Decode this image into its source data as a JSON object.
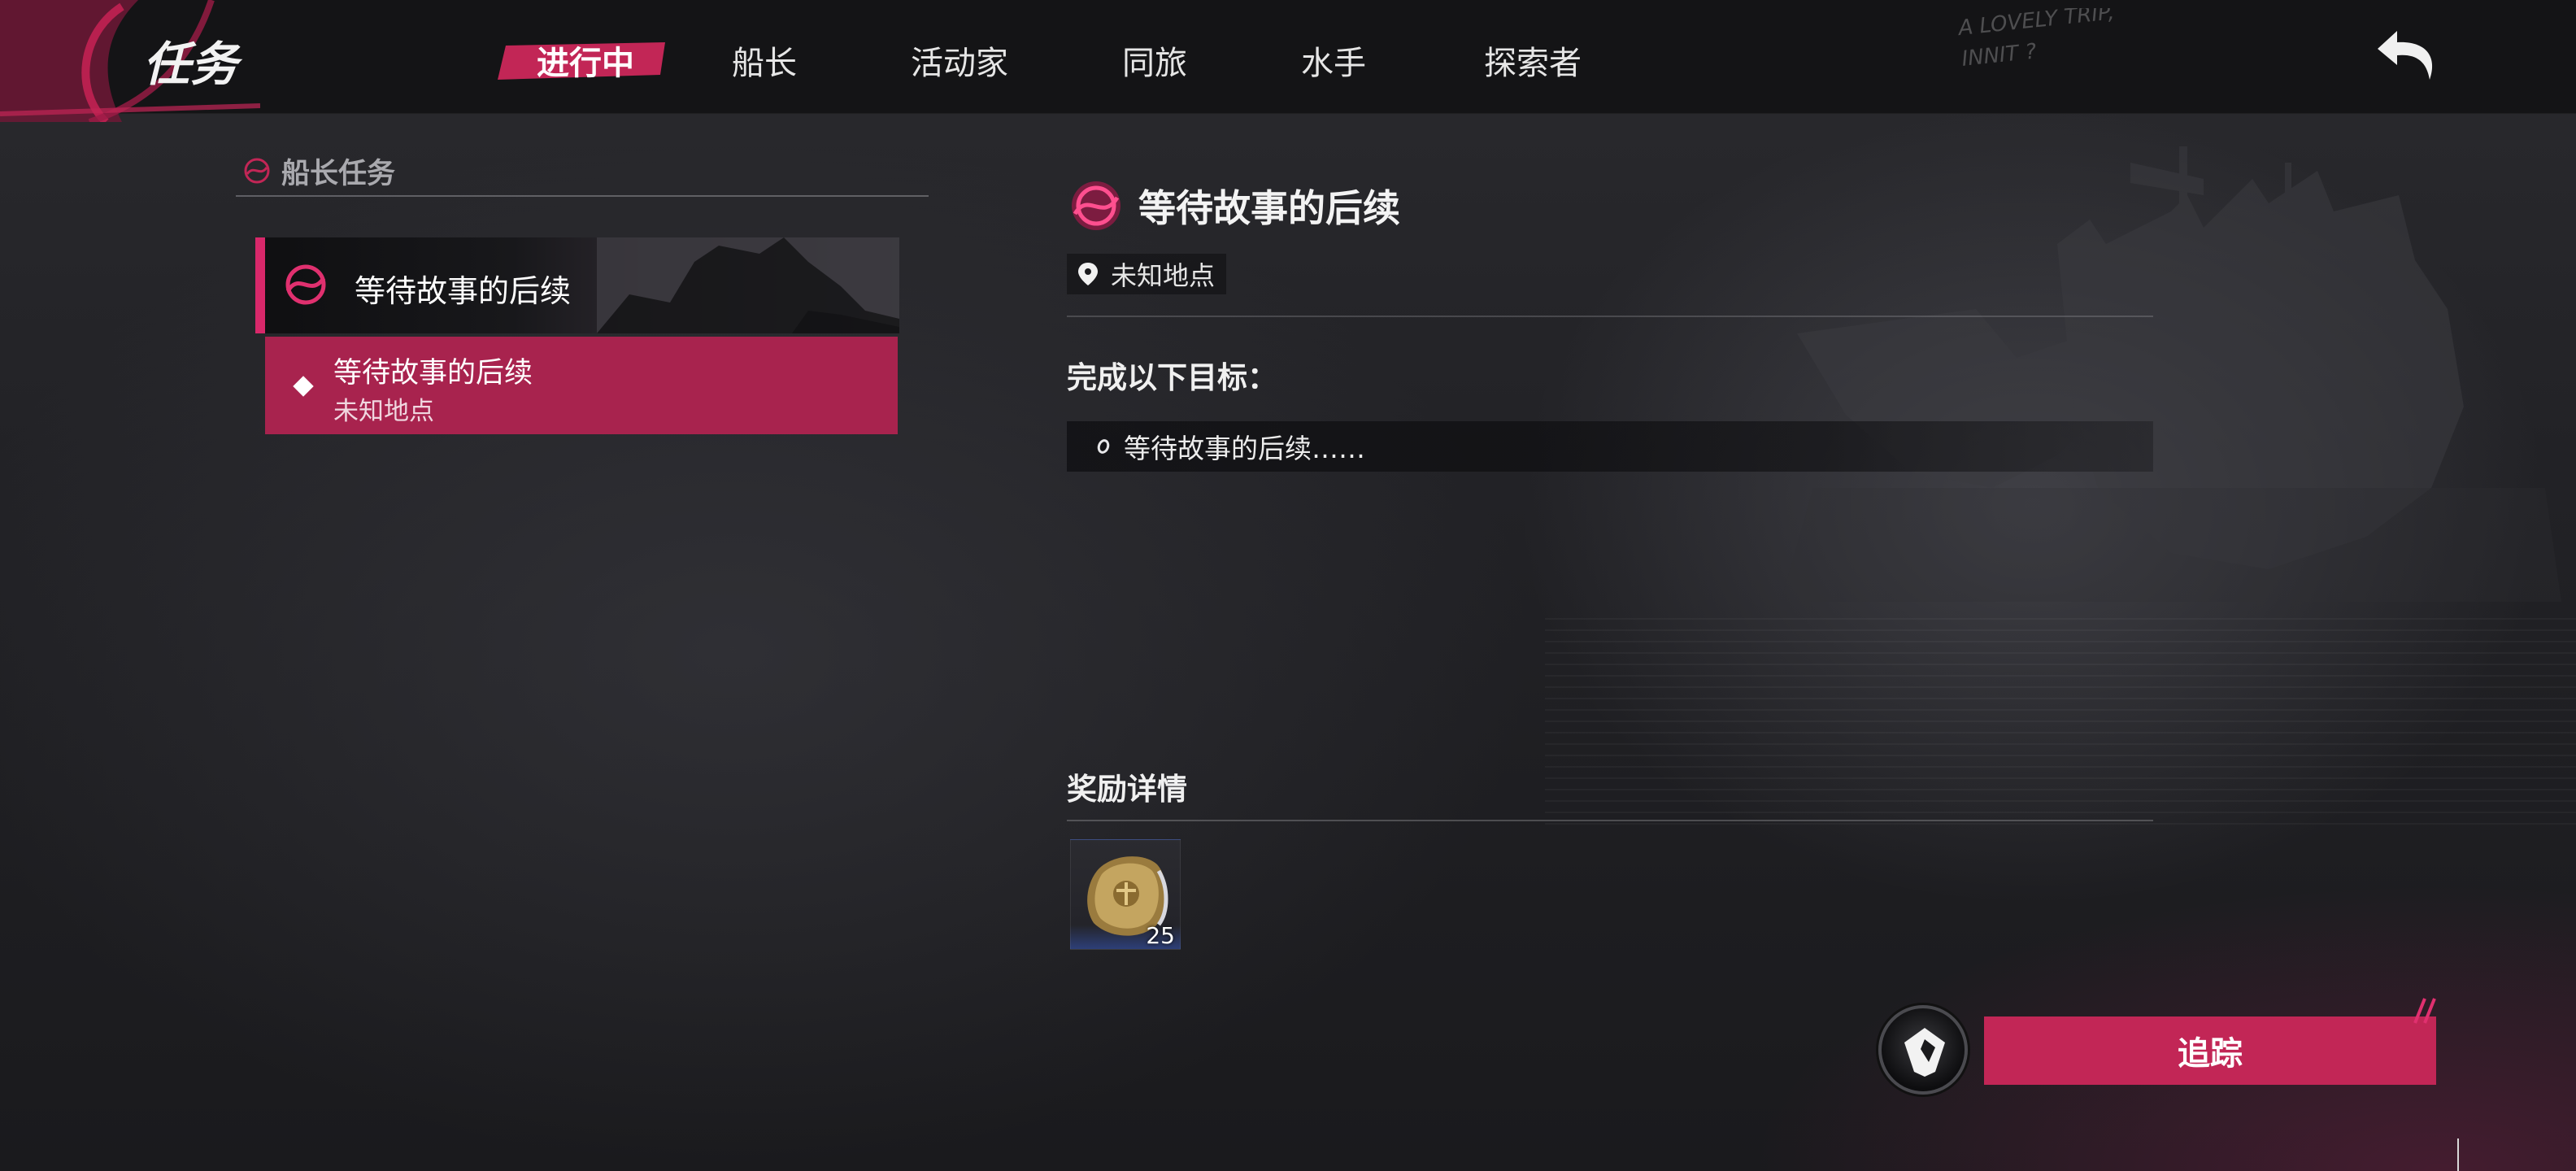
{
  "header": {
    "title": "任务",
    "tabs": [
      {
        "label": "进行中",
        "active": true
      },
      {
        "label": "船长",
        "active": false
      },
      {
        "label": "活动家",
        "active": false
      },
      {
        "label": "同旅",
        "active": false
      },
      {
        "label": "水手",
        "active": false
      },
      {
        "label": "探索者",
        "active": false
      }
    ],
    "back_icon": "back-arrow-icon",
    "scrawl_text": "A LOVELY TRIP, INNIT?"
  },
  "quest_list": {
    "category_title": "船长任务",
    "category_icon": "captain-emblem-icon",
    "selected_quest": {
      "title": "等待故事的后续",
      "icon": "captain-emblem-icon"
    },
    "sub_item": {
      "title": "等待故事的后续",
      "location": "未知地点"
    }
  },
  "detail": {
    "title": "等待故事的后续",
    "icon": "captain-emblem-icon",
    "location": "未知地点",
    "location_icon": "map-pin-icon",
    "objectives_heading": "完成以下目标：",
    "objectives": [
      "等待故事的后续……"
    ],
    "rewards_heading": "奖励详情",
    "rewards": [
      {
        "icon": "gold-coin-icon",
        "count": "25"
      }
    ]
  },
  "actions": {
    "map_icon": "map-location-icon",
    "track_label": "追踪"
  },
  "colors": {
    "accent": "#c22656",
    "accent_bright": "#d8286a",
    "panel_selected": "#a8234e",
    "background": "#1b1b1e"
  }
}
